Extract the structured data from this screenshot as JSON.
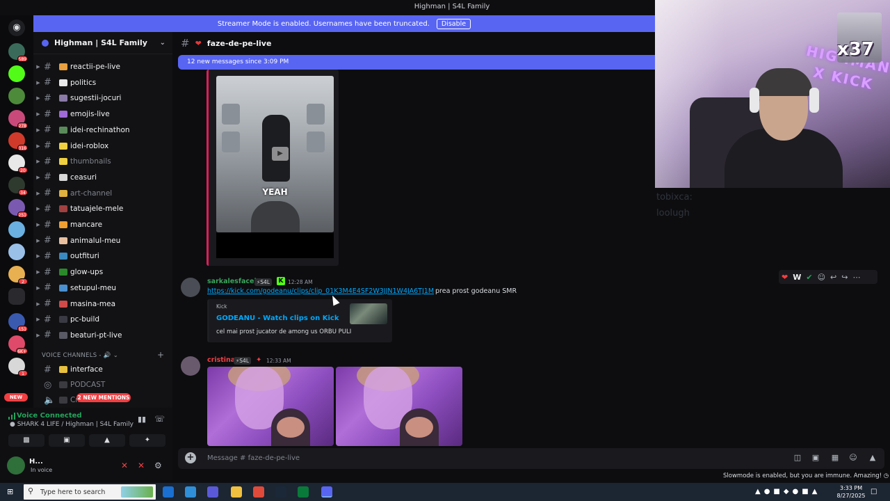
{
  "window": {
    "title": "Highman | S4L Family"
  },
  "banner": {
    "text": "Streamer Mode is enabled. Usernames have been truncated.",
    "button": "Disable"
  },
  "rail": {
    "badges": [
      "589",
      "278",
      "316",
      "20",
      "34",
      "251",
      "2",
      "151",
      "6K+",
      "1",
      "NEW"
    ]
  },
  "sidebar": {
    "server_name": "Highman | S4L Family",
    "channels": [
      {
        "label": "reactii-pe-live",
        "muted": false
      },
      {
        "label": "politics",
        "muted": false
      },
      {
        "label": "sugestii-jocuri",
        "muted": false
      },
      {
        "label": "emojis-live",
        "muted": false
      },
      {
        "label": "idei-rechinathon",
        "muted": false
      },
      {
        "label": "idei-roblox",
        "muted": false
      },
      {
        "label": "thumbnails",
        "muted": true
      },
      {
        "label": "ceasuri",
        "muted": false
      },
      {
        "label": "art-channel",
        "muted": true
      },
      {
        "label": "tatuajele-mele",
        "muted": false
      },
      {
        "label": "mancare",
        "muted": false
      },
      {
        "label": "animalul-meu",
        "muted": false
      },
      {
        "label": "outfituri",
        "muted": false
      },
      {
        "label": "glow-ups",
        "muted": false
      },
      {
        "label": "setupul-meu",
        "muted": false
      },
      {
        "label": "masina-mea",
        "muted": false
      },
      {
        "label": "pc-build",
        "muted": false
      },
      {
        "label": "beaturi-pt-live",
        "muted": false
      }
    ],
    "voice_category": "VOICE CHANNELS -",
    "voice_channels": [
      {
        "label": "interface"
      },
      {
        "label": "PODCAST"
      },
      {
        "label": "Cr..."
      }
    ],
    "mentions_pill": "2 NEW MENTIONS"
  },
  "voice_panel": {
    "status": "Voice Connected",
    "location": "SHARK 4 LIFE / Highman | S4L Family",
    "user_name": "H...",
    "user_status": "In voice"
  },
  "chat": {
    "channel_name": "faze-de-pe-live",
    "new_messages": "12 new messages since 3:09 PM",
    "video_caption": "YEAH",
    "messages": [
      {
        "author": "sarkalesfaceit",
        "tag": "S4L",
        "time": "12:28 AM",
        "link": "https://kick.com/godeanu/clips/clip_01K3M4E4SF2W3JJN1W4JA6TJ1M",
        "text": "prea prost godeanu SMR",
        "embed": {
          "provider": "Kick",
          "title": "GODEANU - Watch clips on Kick",
          "description": "cel mai prost jucator de among us ORBU PULI"
        }
      },
      {
        "author": "cristina",
        "tag": "S4L",
        "time": "12:33 AM"
      }
    ],
    "composer_placeholder": "Message # faze-de-pe-live",
    "slowmode_notice": "Slowmode is enabled, but you are immune. Amazing!",
    "hover_reaction": "W"
  },
  "webcam": {
    "overlay_text": "x37",
    "neon_text": "HIGHMAN X KICK"
  },
  "overlay_ghost": {
    "line1": "tobixca:",
    "line2": "loolugh"
  },
  "taskbar": {
    "search_placeholder": "Type here to search",
    "time": "3:33 PM",
    "date": "8/27/2025"
  },
  "colors": {
    "accent": "#5865f2",
    "danger": "#f23f43",
    "online": "#23a55a",
    "link": "#00a8fc"
  }
}
